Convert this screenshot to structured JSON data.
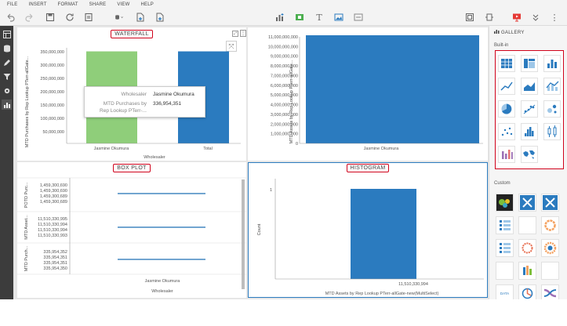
{
  "menu": [
    "FILE",
    "INSERT",
    "FORMAT",
    "SHARE",
    "VIEW",
    "HELP"
  ],
  "colors": {
    "accent_red": "#d0021b",
    "bar_green": "#8fce7a",
    "bar_blue": "#2b7bbf",
    "line_blue": "#1f6fb5",
    "rail": "#3c3c3c",
    "canvas": "#e6e6e6"
  },
  "toolbar": {
    "icons": [
      "undo-icon",
      "redo-icon",
      "save-icon",
      "refresh-icon",
      "export-icon",
      "data-source-icon",
      "new-page-icon",
      "add-page-icon",
      "insert-chart-icon",
      "insert-filter-icon",
      "insert-text-icon",
      "insert-image-icon",
      "insert-html-icon",
      "layout-icon",
      "fit-icon",
      "present-icon",
      "collapse-icon",
      "more-icon"
    ]
  },
  "waterfall": {
    "title": "WATERFALL",
    "ylabel": "MTD Purchases by Rep Lookup PTerr-allGate...",
    "xlabel": "Wholesaler",
    "ticks": [
      "350,000,000",
      "300,000,000",
      "250,000,000",
      "200,000,000",
      "150,000,000",
      "100,000,000",
      "50,000,000"
    ],
    "categories": [
      "Jasmine Okumura",
      "Total"
    ]
  },
  "tooltip": {
    "k1": "Wholesaler",
    "v1": "Jasmine Okumura",
    "k2": "MTD Purchases by",
    "k2b": "Rep Lookup PTerr-...",
    "v2": "336,954,351"
  },
  "gauge": {
    "ylabel": "MTD Assets by Rep Lookup PTerr-allGate...",
    "xlabel": "Jasmine Okumura",
    "ticks": [
      "11,000,000,000",
      "10,000,000,000",
      "9,000,000,000",
      "8,000,000,000",
      "7,000,000,000",
      "6,000,000,000",
      "5,000,000,000",
      "4,000,000,000",
      "3,000,000,000",
      "2,000,000,000",
      "1,000,000,000",
      "0"
    ]
  },
  "boxplot": {
    "title": "BOX PLOT",
    "rows": [
      {
        "label": "POTD Purc...",
        "values": [
          "1,459,300,690",
          "1,459,300,690",
          "1,459,300,689",
          "1,459,300,689"
        ]
      },
      {
        "label": "MTD Asset...",
        "values": [
          "11,510,330,995",
          "11,510,330,994",
          "11,510,330,994",
          "11,510,330,993"
        ]
      },
      {
        "label": "MTD Purch...",
        "values": [
          "335,954,352",
          "335,954,351",
          "335,954,351",
          "335,954,350"
        ]
      }
    ],
    "xcat": "Jasmine Okumura",
    "xlabel": "Wholesaler"
  },
  "histogram": {
    "title": "HISTOGRAM",
    "ylabel": "Count",
    "ytick": "1",
    "xtick": "11,510,330,994",
    "xlabel": "MTD Assets by Rep Lookup PTerr-allGate-new(MultiSelect)"
  },
  "chart_data": [
    {
      "type": "bar",
      "title": "WATERFALL",
      "categories": [
        "Jasmine Okumura",
        "Total"
      ],
      "values": [
        336954351,
        336954351
      ],
      "xlabel": "Wholesaler",
      "ylabel": "MTD Purchases by Rep Lookup PTerr-allGate...",
      "ylim": [
        0,
        350000000
      ]
    },
    {
      "type": "bar",
      "categories": [
        "Jasmine Okumura"
      ],
      "values": [
        11510330994
      ],
      "ylabel": "MTD Assets by Rep Lookup PTerr-allGate...",
      "ylim": [
        0,
        11000000000
      ]
    },
    {
      "type": "bar",
      "title": "HISTOGRAM",
      "categories": [
        "11,510,330,994"
      ],
      "values": [
        1
      ],
      "ylabel": "Count"
    }
  ],
  "gallery": {
    "header": "GALLERY",
    "builtin_label": "Built-in",
    "custom_label": "Custom",
    "builtin_icons": [
      "grid-table-icon",
      "crosstab-icon",
      "bar-chart-icon",
      "line-chart-icon",
      "area-chart-icon",
      "combo-chart-icon",
      "pie-chart-icon",
      "scatter-line-icon",
      "bubble-icon",
      "scatter-icon",
      "histogram-icon",
      "box-plot-icon",
      "waterfall-icon",
      "map-icon"
    ],
    "custom_icons": [
      "heatmap-icon",
      "network-icon",
      "network-alt-icon",
      "list-icon",
      "blank-icon",
      "donut-icon",
      "list-alt-icon",
      "ring-icon",
      "sunburst-icon",
      "blank-alt-icon",
      "stacked-bar-icon",
      "blank-icon-2",
      "word-cloud-icon",
      "radial-icon",
      "sankey-icon"
    ],
    "word_cloud_text": "DATA CLOUD"
  }
}
